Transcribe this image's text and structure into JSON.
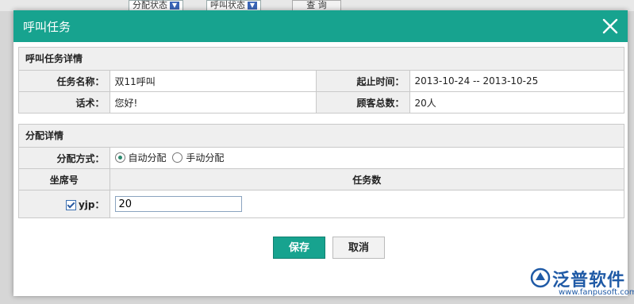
{
  "background": {
    "select1": "分配状态",
    "select2": "呼叫状态",
    "query_button": "查 询"
  },
  "dialog": {
    "title": "呼叫任务",
    "close_icon": "close-icon"
  },
  "task_details": {
    "section_title": "呼叫任务详情",
    "task_name_label": "任务名称：",
    "task_name_value": "双11呼叫",
    "period_label": "起止时间：",
    "period_value": "2013-10-24 -- 2013-10-25",
    "script_label": "话术：",
    "script_value": "您好!",
    "customers_label": "顾客总数：",
    "customers_value": "20人"
  },
  "assignment": {
    "section_title": "分配详情",
    "method_label": "分配方式：",
    "options": [
      {
        "label": "自动分配",
        "selected": true
      },
      {
        "label": "手动分配",
        "selected": false
      }
    ],
    "col_seat": "坐席号",
    "col_tasks": "任务数",
    "agent_name": "yjp：",
    "agent_checked": true,
    "agent_task_count": "20"
  },
  "buttons": {
    "save": "保存",
    "cancel": "取消"
  },
  "watermark": {
    "name": "泛普软件",
    "url": "www.fanpusoft.com"
  },
  "colors": {
    "accent": "#17a38f",
    "header_bg": "#efefef",
    "border": "#c9c9c9"
  }
}
